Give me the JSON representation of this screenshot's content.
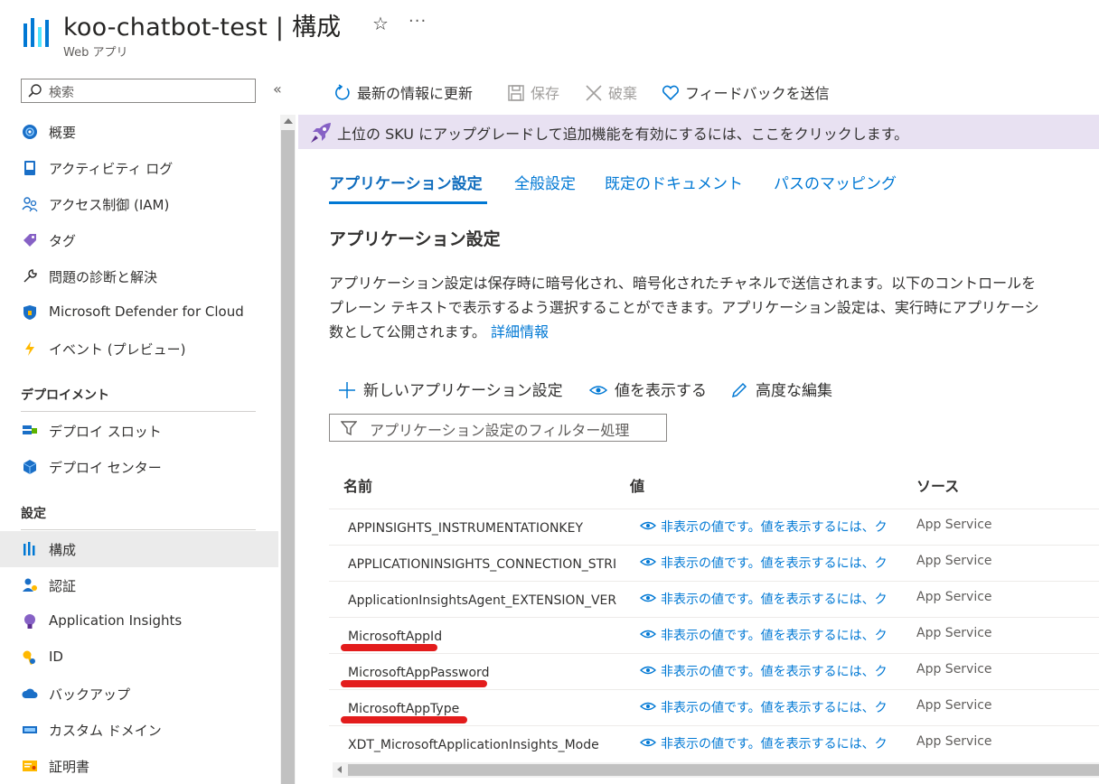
{
  "header": {
    "title": "koo-chatbot-test | 構成",
    "subtitle": "Web アプリ",
    "favorite_icon": "star-icon",
    "more_icon": "ellipsis-icon"
  },
  "sidebar": {
    "search_placeholder": "検索",
    "items": [
      {
        "label": "概要",
        "icon": "globe-icon"
      },
      {
        "label": "アクティビティ ログ",
        "icon": "log-icon"
      },
      {
        "label": "アクセス制御 (IAM)",
        "icon": "people-icon"
      },
      {
        "label": "タグ",
        "icon": "tag-icon"
      },
      {
        "label": "問題の診断と解決",
        "icon": "wrench-icon"
      },
      {
        "label": "Microsoft Defender for Cloud",
        "icon": "shield-icon"
      },
      {
        "label": "イベント (プレビュー)",
        "icon": "lightning-icon"
      }
    ],
    "section_deploy": {
      "heading": "デプロイメント",
      "items": [
        {
          "label": "デプロイ スロット",
          "icon": "slots-icon"
        },
        {
          "label": "デプロイ センター",
          "icon": "cube-icon"
        }
      ]
    },
    "section_settings": {
      "heading": "設定",
      "items": [
        {
          "label": "構成",
          "icon": "config-icon",
          "active": true
        },
        {
          "label": "認証",
          "icon": "auth-icon"
        },
        {
          "label": "Application Insights",
          "icon": "bulb-icon"
        },
        {
          "label": "ID",
          "icon": "key-icon"
        },
        {
          "label": "バックアップ",
          "icon": "cloud-icon"
        },
        {
          "label": "カスタム ドメイン",
          "icon": "domain-icon"
        },
        {
          "label": "証明書",
          "icon": "certificate-icon"
        }
      ]
    }
  },
  "toolbar": {
    "refresh_label": "最新の情報に更新",
    "save_label": "保存",
    "discard_label": "破棄",
    "feedback_label": "フィードバックを送信"
  },
  "banner": {
    "text": "上位の SKU にアップグレードして追加機能を有効にするには、ここをクリックします。"
  },
  "tabs": [
    {
      "label": "アプリケーション設定",
      "active": true
    },
    {
      "label": "全般設定"
    },
    {
      "label": "既定のドキュメント"
    },
    {
      "label": "パスのマッピング"
    }
  ],
  "section": {
    "title": "アプリケーション設定",
    "description_line1": "アプリケーション設定は保存時に暗号化され、暗号化されたチャネルで送信されます。以下のコントロールを",
    "description_line2": "プレーン テキストで表示するよう選択することができます。アプリケーション設定は、実行時にアプリケーシ",
    "description_line3": "数として公開されます。",
    "learn_more": "詳細情報"
  },
  "actions": {
    "new_label": "新しいアプリケーション設定",
    "show_values_label": "値を表示する",
    "advanced_edit_label": "高度な編集",
    "filter_placeholder": "アプリケーション設定のフィルター処理"
  },
  "table": {
    "headers": {
      "name": "名前",
      "value": "値",
      "source": "ソース"
    },
    "rows": [
      {
        "name": "APPINSIGHTS_INSTRUMENTATIONKEY",
        "value": "非表示の値です。値を表示するには、ク",
        "source": "App Service",
        "marked": false
      },
      {
        "name": "APPLICATIONINSIGHTS_CONNECTION_STRIN",
        "value": "非表示の値です。値を表示するには、ク",
        "source": "App Service",
        "marked": false
      },
      {
        "name": "ApplicationInsightsAgent_EXTENSION_VERSIO",
        "value": "非表示の値です。値を表示するには、ク",
        "source": "App Service",
        "marked": false
      },
      {
        "name": "MicrosoftAppId",
        "value": "非表示の値です。値を表示するには、ク",
        "source": "App Service",
        "marked": true
      },
      {
        "name": "MicrosoftAppPassword",
        "value": "非表示の値です。値を表示するには、ク",
        "source": "App Service",
        "marked": true
      },
      {
        "name": "MicrosoftAppType",
        "value": "非表示の値です。値を表示するには、ク",
        "source": "App Service",
        "marked": true
      },
      {
        "name": "XDT_MicrosoftApplicationInsights_Mode",
        "value": "非表示の値です。値を表示するには、ク",
        "source": "App Service",
        "marked": false
      }
    ]
  },
  "colors": {
    "accent": "#0078d4",
    "banner_bg": "#e8e1f2",
    "annotation_red": "#e31c1c"
  }
}
